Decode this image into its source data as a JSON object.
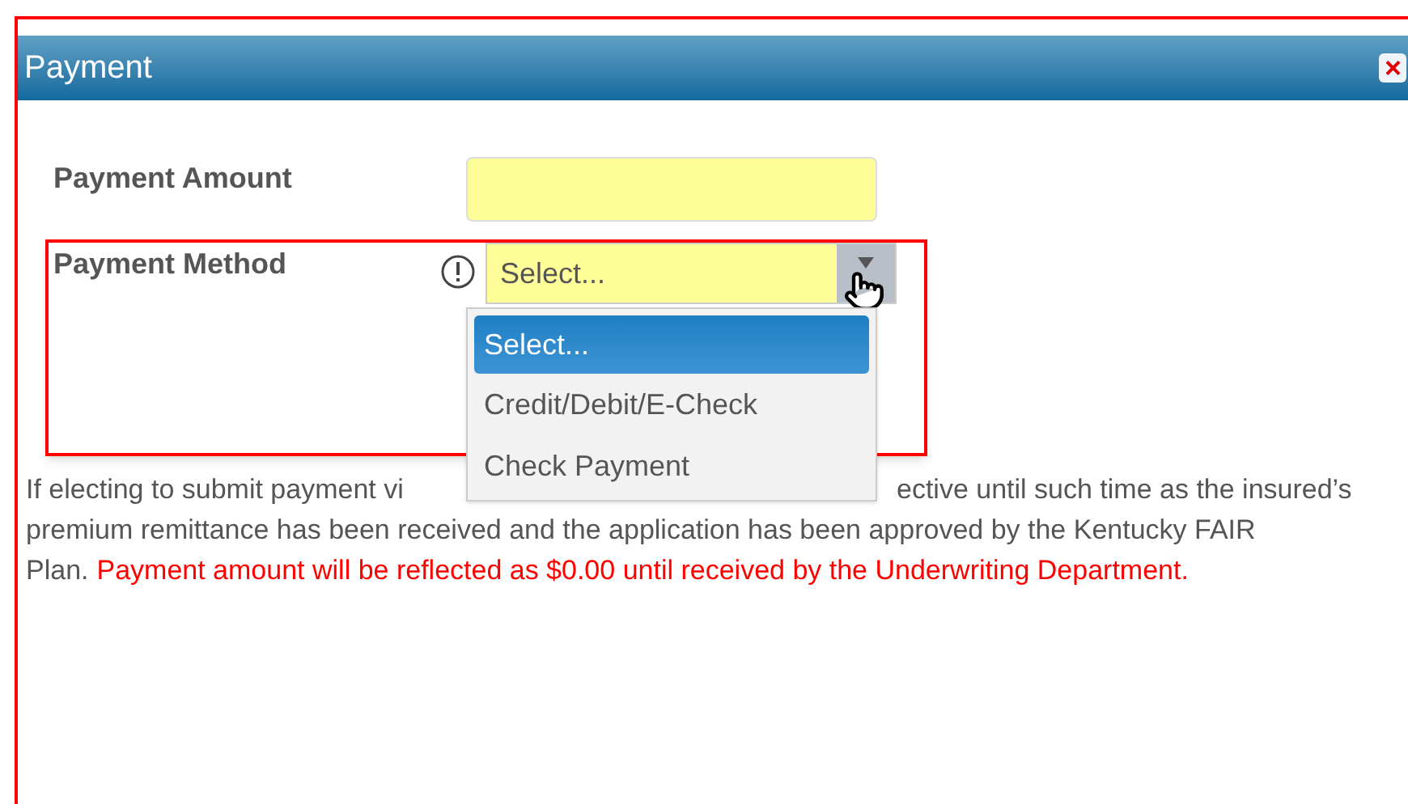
{
  "dialog": {
    "title": "Payment",
    "close": "×"
  },
  "amount": {
    "label": "Payment Amount"
  },
  "method": {
    "label": "Payment Method",
    "value": "Select...",
    "expanded": true,
    "options": [
      {
        "label": "Select...",
        "selected": true
      },
      {
        "label": "Credit/Debit/E-Check",
        "selected": false
      },
      {
        "label": "Check Payment",
        "selected": false
      }
    ]
  },
  "notice": {
    "line_1_start": "If electing to submit payment vi",
    "line_1_end": "ective until such time as the insured’s",
    "line_2": "premium remittance has been received and the application has been approved by the Kentucky FAIR",
    "line_3_start": "Plan.",
    "warning": "Payment amount will be reflected as $0.00 until received by the Underwriting Department."
  }
}
